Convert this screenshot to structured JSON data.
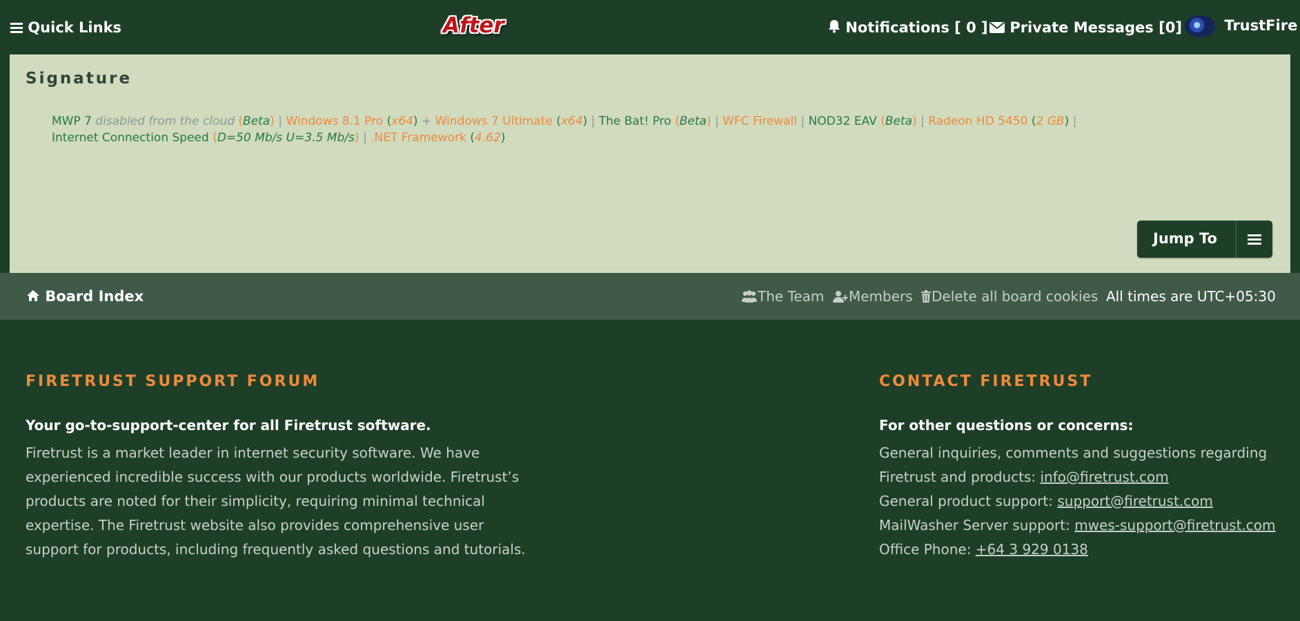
{
  "header": {
    "quick_links": "Quick Links",
    "logo_text": "After",
    "notifications": "Notifications [ 0 ]",
    "private_messages": "Private Messages [0]",
    "username": "TrustFire"
  },
  "signature": {
    "title": "Signature",
    "line1": [
      {
        "t": "MWP 7 ",
        "c": "g"
      },
      {
        "t": "disabled from the cloud ",
        "c": "gray"
      },
      {
        "t": "(",
        "c": "o"
      },
      {
        "t": "Beta",
        "c": "gi"
      },
      {
        "t": ")",
        "c": "o"
      },
      {
        "t": " | ",
        "c": "pipe"
      },
      {
        "t": "Windows 8.1 Pro ",
        "c": "o"
      },
      {
        "t": "(",
        "c": "g"
      },
      {
        "t": "x64",
        "c": "oi"
      },
      {
        "t": ")",
        "c": "g"
      },
      {
        "t": " + ",
        "c": "pipe"
      },
      {
        "t": "Windows 7 Ultimate ",
        "c": "o"
      },
      {
        "t": "(",
        "c": "g"
      },
      {
        "t": "x64",
        "c": "oi"
      },
      {
        "t": ")",
        "c": "g"
      },
      {
        "t": " | ",
        "c": "pipe"
      },
      {
        "t": "The Bat! Pro ",
        "c": "g"
      },
      {
        "t": "(",
        "c": "o"
      },
      {
        "t": "Beta",
        "c": "gi"
      },
      {
        "t": ")",
        "c": "o"
      },
      {
        "t": " | ",
        "c": "pipe"
      },
      {
        "t": "WFC Firewall",
        "c": "o"
      },
      {
        "t": " | ",
        "c": "pipe"
      },
      {
        "t": "NOD32 EAV ",
        "c": "g"
      },
      {
        "t": "(",
        "c": "o"
      },
      {
        "t": "Beta",
        "c": "gi"
      },
      {
        "t": ")",
        "c": "o"
      },
      {
        "t": " | ",
        "c": "pipe"
      },
      {
        "t": "Radeon HD 5450 ",
        "c": "o"
      },
      {
        "t": "(",
        "c": "g"
      },
      {
        "t": "2 GB",
        "c": "oi"
      },
      {
        "t": ")",
        "c": "g"
      },
      {
        "t": " |",
        "c": "pipe"
      }
    ],
    "line2": [
      {
        "t": "Internet Connection Speed ",
        "c": "g"
      },
      {
        "t": "(",
        "c": "o"
      },
      {
        "t": "D=50 Mb/s U=3.5 Mb/s",
        "c": "gi"
      },
      {
        "t": ")",
        "c": "o"
      },
      {
        "t": " | ",
        "c": "pipe"
      },
      {
        "t": ".NET Framework ",
        "c": "o"
      },
      {
        "t": "(",
        "c": "g"
      },
      {
        "t": "4.62",
        "c": "oi"
      },
      {
        "t": ")",
        "c": "g"
      }
    ],
    "jump_to": "Jump To"
  },
  "board_bar": {
    "board_index": "Board Index",
    "the_team": "The Team",
    "members": "Members",
    "delete_cookies": "Delete all board cookies",
    "times": "All times are UTC+05:30"
  },
  "footer": {
    "left_heading": "FIRETRUST SUPPORT FORUM",
    "left_bold": "Your go-to-support-center for all Firetrust software.",
    "left_lines": [
      "Firetrust is a market leader in internet security software. We have",
      "experienced incredible success with our products worldwide. Firetrust’s",
      "products are noted for their simplicity, requiring minimal technical",
      "expertise. The Firetrust website also provides comprehensive user",
      "support for products, including frequently asked questions and tutorials."
    ],
    "right_heading": "CONTACT FIRETRUST",
    "right_bold": "For other questions or concerns:",
    "general_inquiries": "General inquiries, comments and suggestions regarding",
    "firetrust_products": "Firetrust and products: ",
    "info_email": "info@firetrust.com",
    "product_support": "General product support: ",
    "support_email": "support@firetrust.com",
    "mws_support": "MailWasher Server support: ",
    "mws_email": "mwes-support@firetrust.com",
    "office_phone": "Office Phone: ",
    "phone": "+64 3 929 0138"
  },
  "colors": {
    "background": "#1e3f27",
    "panel": "#d1dbbd",
    "accent_orange": "#f08a3c",
    "accent_green": "#267a44",
    "board_bar": "#405a48"
  },
  "icons": [
    "menu-icon",
    "bell-icon",
    "envelope-icon",
    "home-icon",
    "team-icon",
    "add-member-icon",
    "trash-icon"
  ]
}
